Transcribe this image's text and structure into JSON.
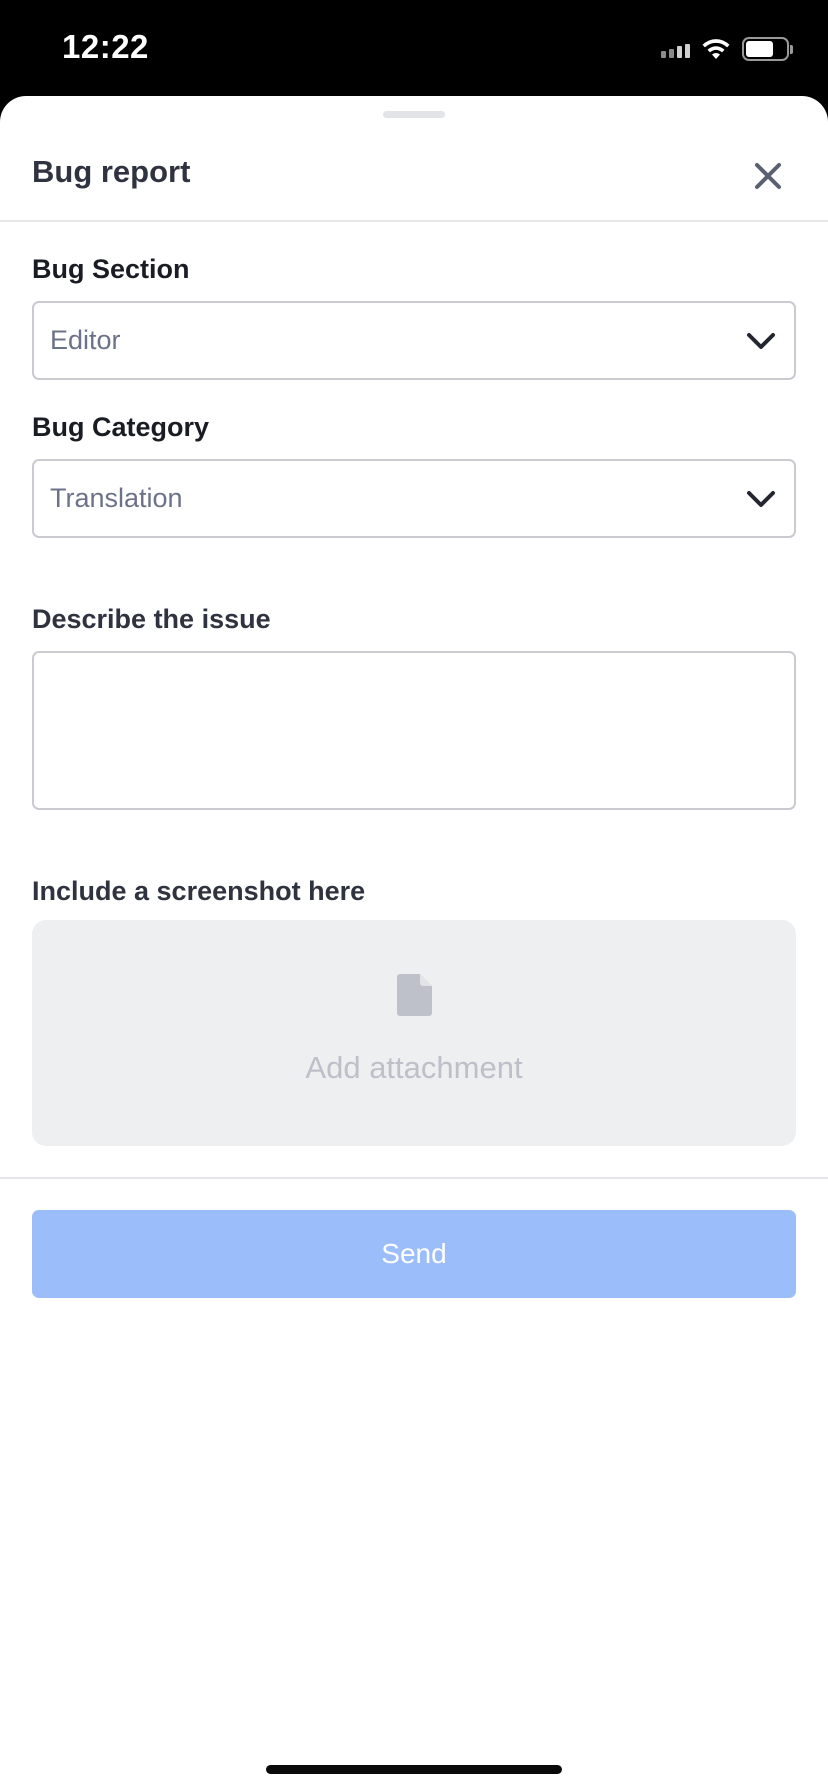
{
  "status_bar": {
    "time": "12:22",
    "battery_level": 0.7
  },
  "sheet": {
    "title": "Bug report"
  },
  "form": {
    "bug_section": {
      "label": "Bug Section",
      "value": "Editor"
    },
    "bug_category": {
      "label": "Bug Category",
      "value": "Translation"
    },
    "description": {
      "label": "Describe the issue",
      "value": ""
    },
    "screenshot": {
      "label": "Include a screenshot here",
      "attach_label": "Add attachment"
    }
  },
  "actions": {
    "send_label": "Send"
  },
  "colors": {
    "primary_disabled": "#9bbdfa",
    "title_text": "#2f3340",
    "placeholder_text": "#6c7289"
  }
}
